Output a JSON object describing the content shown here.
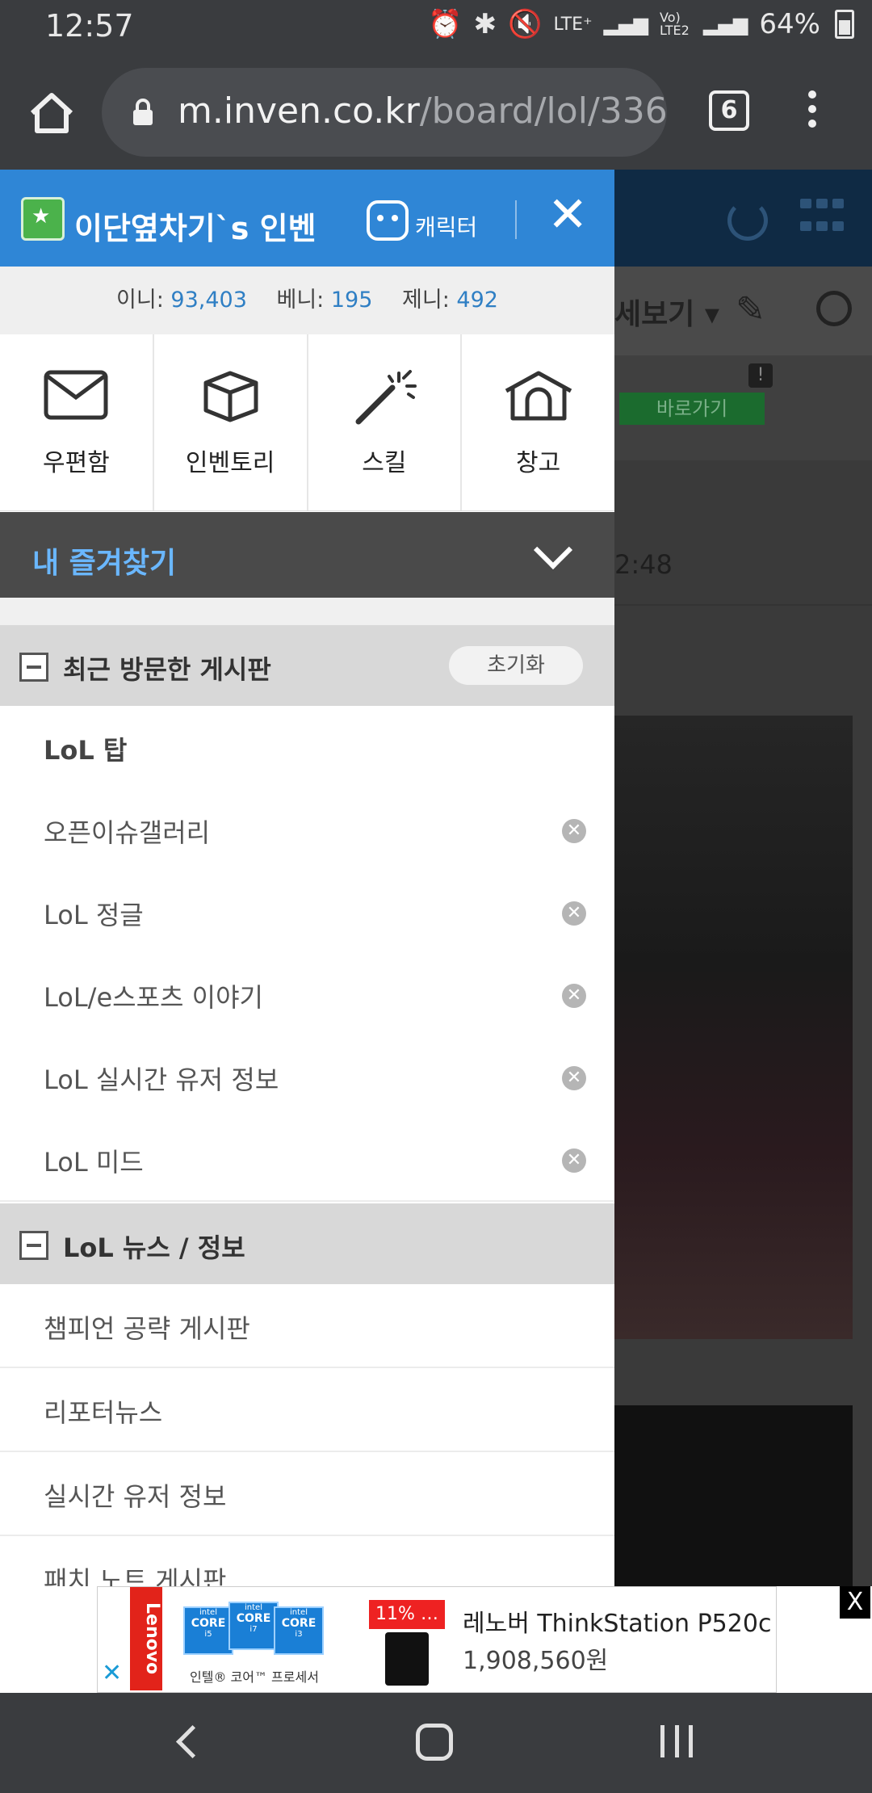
{
  "status_bar": {
    "time": "12:57",
    "icons": [
      "alarm-icon",
      "bluetooth-icon",
      "mute-icon",
      "lte-plus-icon",
      "signal-icon",
      "volte-lte2-icon",
      "signal-icon",
      "battery-icon"
    ],
    "lte_label": "LTE⁺",
    "volte_label": "Vo) LTE2",
    "battery": "64%"
  },
  "browser": {
    "url_host": "m.inven.co.kr",
    "url_path": "/board/lol/336",
    "tab_count": "6"
  },
  "drawer": {
    "title": "이단옆차기`s 인벤",
    "character_label": "캐릭터",
    "close_label": "✕",
    "points": [
      {
        "label": "이니:",
        "value": "93,403"
      },
      {
        "label": "베니:",
        "value": "195"
      },
      {
        "label": "제니:",
        "value": "492"
      }
    ],
    "quick_menu": [
      {
        "label": "우편함",
        "icon": "mail-icon"
      },
      {
        "label": "인벤토리",
        "icon": "box-icon"
      },
      {
        "label": "스킬",
        "icon": "magic-wand-icon"
      },
      {
        "label": "창고",
        "icon": "warehouse-icon"
      }
    ],
    "favorites_title": "내 즐겨찾기",
    "recent": {
      "title": "최근 방문한 게시판",
      "reset_label": "초기화",
      "items": [
        {
          "label": "LoL 탑",
          "removable": false
        },
        {
          "label": "오픈이슈갤러리",
          "removable": true
        },
        {
          "label": "LoL 정글",
          "removable": true
        },
        {
          "label": "LoL/e스포츠 이야기",
          "removable": true
        },
        {
          "label": "LoL 실시간 유저 정보",
          "removable": true
        },
        {
          "label": "LoL 미드",
          "removable": true
        }
      ]
    },
    "news": {
      "title": "LoL 뉴스 / 정보",
      "items": [
        "챔피언 공략 게시판",
        "리포터뉴스",
        "실시간 유저 정보",
        "패치 노트 게시판"
      ]
    }
  },
  "background_page": {
    "view_label": "세보기 ▾",
    "go_button": "바로가기",
    "time_fragment": "2:48"
  },
  "ad": {
    "brand": "Lenovo",
    "chip_brand": "intel",
    "chip_label": "CORE",
    "chip_models": [
      "i5",
      "i7",
      "i3"
    ],
    "sub_text": "인텔® 코어™ 프로세서",
    "discount": "11% …",
    "product": "레노버 ThinkStation P520c",
    "price": "1,908,560원",
    "close": "X",
    "choice_close": "✕"
  }
}
